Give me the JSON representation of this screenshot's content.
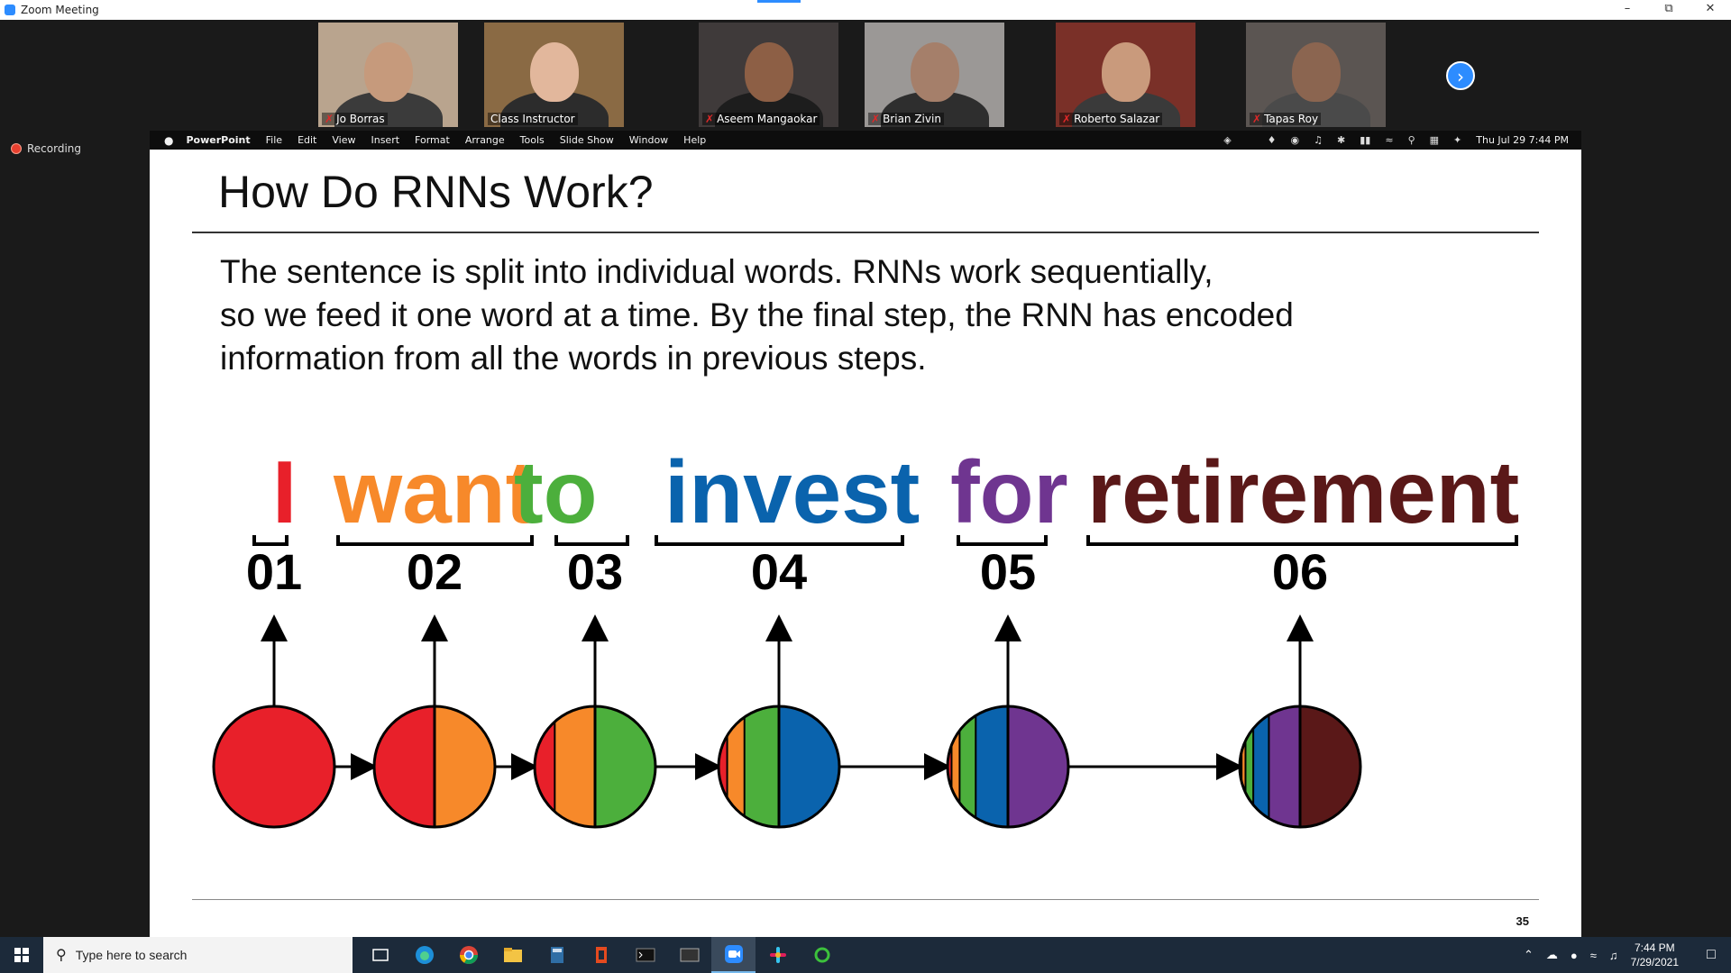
{
  "window": {
    "title": "Zoom Meeting"
  },
  "participants": [
    {
      "name": "Jo Borras",
      "muted": true,
      "bg": "#b9a48e",
      "skin": "#c69a7c",
      "shirt": "#3b3b3b"
    },
    {
      "name": "Class Instructor",
      "muted": false,
      "active": true,
      "bg": "#8a6a44",
      "skin": "#e2b79c",
      "shirt": "#2c2c2c"
    },
    {
      "name": "Aseem Mangaokar",
      "muted": true,
      "bg": "#3f3a3a",
      "skin": "#8d5f45",
      "shirt": "#1d1d1d"
    },
    {
      "name": "Brian Zivin",
      "muted": true,
      "bg": "#9b9896",
      "skin": "#a57f6a",
      "shirt": "#2e2e2e"
    },
    {
      "name": "Roberto Salazar",
      "muted": true,
      "bg": "#7a3028",
      "skin": "#c99a7c",
      "shirt": "#3a3a3a"
    },
    {
      "name": "Tapas Roy",
      "muted": true,
      "bg": "#5b5552",
      "skin": "#8b6550",
      "shirt": "#4a4a4a"
    }
  ],
  "recording": {
    "label": "Recording"
  },
  "menubar": {
    "app": "PowerPoint",
    "items": [
      "File",
      "Edit",
      "View",
      "Insert",
      "Format",
      "Arrange",
      "Tools",
      "Slide Show",
      "Window",
      "Help"
    ],
    "clock": "Thu Jul 29  7:44 PM"
  },
  "slide": {
    "title": "How Do RNNs Work?",
    "body": [
      "The sentence is split into individual words. RNNs work sequentially,",
      "so we feed it one word at a time. By the final step, the RNN has encoded",
      "information from all the words in previous steps."
    ],
    "words": [
      {
        "text": "I",
        "color": "#e8202a",
        "step": "01"
      },
      {
        "text": "want",
        "color": "#f7892a",
        "step": "02"
      },
      {
        "text": "to",
        "color": "#4caf3c",
        "step": "03"
      },
      {
        "text": "invest",
        "color": "#0a63ad",
        "step": "04"
      },
      {
        "text": "for",
        "color": "#6f3590",
        "step": "05"
      },
      {
        "text": "retirement",
        "color": "#5a1818",
        "step": "06"
      }
    ],
    "page_number": "35"
  },
  "taskbar": {
    "search_placeholder": "Type here to search",
    "time": "7:44 PM",
    "date": "7/29/2021"
  }
}
